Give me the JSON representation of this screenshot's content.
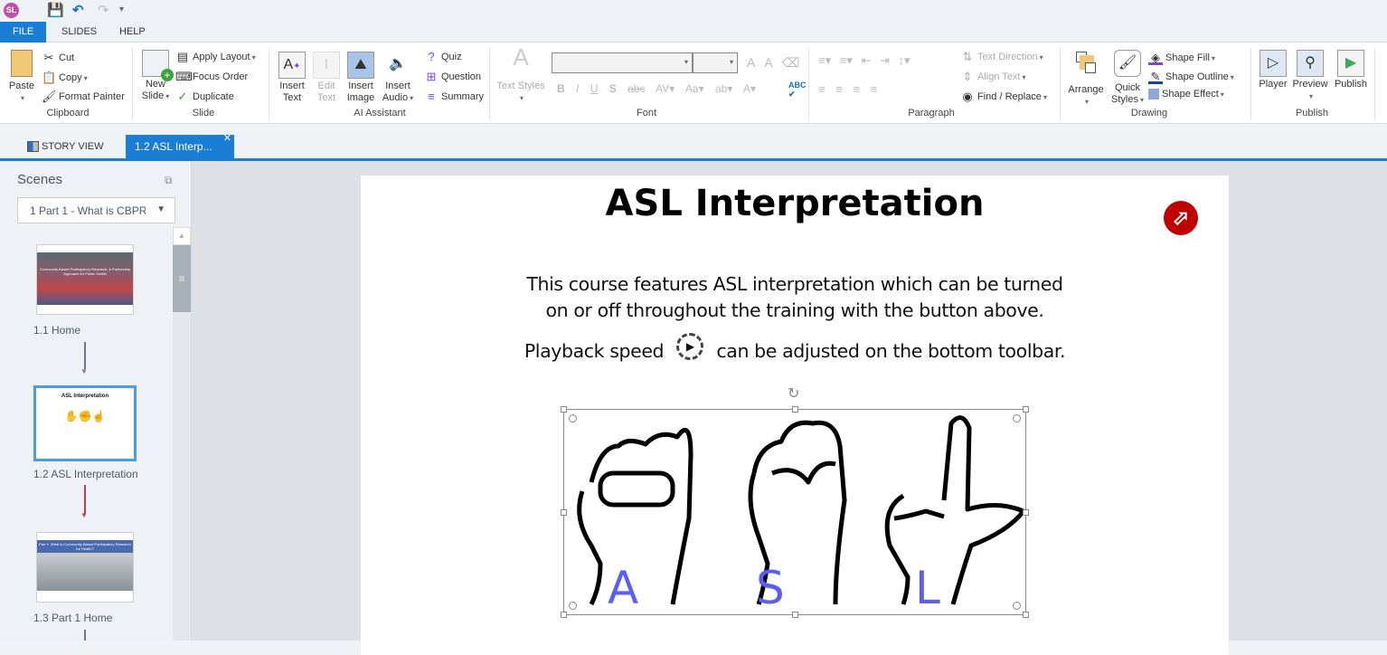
{
  "app": {
    "logo": "SL"
  },
  "menu_tabs": [
    "FILE",
    "SLIDES",
    "HELP"
  ],
  "ribbon": {
    "clipboard": {
      "label": "Clipboard",
      "paste": "Paste",
      "cut": "Cut",
      "copy": "Copy",
      "format_painter": "Format Painter"
    },
    "slide": {
      "label": "Slide",
      "new_slide_1": "New",
      "new_slide_2": "Slide",
      "apply_layout": "Apply Layout",
      "focus_order": "Focus Order",
      "duplicate": "Duplicate"
    },
    "ai": {
      "label": "AI Assistant",
      "insert_text": [
        "Insert",
        "Text"
      ],
      "edit_text": [
        "Edit",
        "Text"
      ],
      "insert_image": [
        "Insert",
        "Image"
      ],
      "insert_audio": [
        "Insert",
        "Audio"
      ],
      "quiz": "Quiz",
      "question": "Question",
      "summary": "Summary"
    },
    "font": {
      "label": "Font",
      "text_styles": "Text Styles",
      "font_name": "",
      "font_size": ""
    },
    "paragraph": {
      "label": "Paragraph",
      "text_direction": "Text Direction",
      "align_text": "Align Text",
      "find_replace": "Find / Replace"
    },
    "drawing": {
      "label": "Drawing",
      "arrange": "Arrange",
      "quick_styles": [
        "Quick",
        "Styles"
      ],
      "shape_fill": "Shape Fill",
      "shape_outline": "Shape Outline",
      "shape_effect": "Shape Effect"
    },
    "publish": {
      "label": "Publish",
      "player": "Player",
      "preview": "Preview",
      "publish": "Publish"
    }
  },
  "doc_tabs": {
    "story_view": "STORY VIEW",
    "active": "1.2 ASL Interp..."
  },
  "scenes": {
    "title": "Scenes",
    "selected_scene": "1 Part 1 - What is CBPR",
    "slides": [
      {
        "label": "1.1 Home",
        "thumb_text": "Community-Based Participatory Research: A Partnership Approach for Public Health"
      },
      {
        "label": "1.2 ASL Interpretation",
        "thumb_text": "ASL Interpretation"
      },
      {
        "label": "1.3 Part 1 Home",
        "thumb_text": "Part 1: What is Community-Based Participatory Research for Health?"
      }
    ]
  },
  "slide": {
    "title": "ASL Interpretation",
    "para1_line1": "This course features ASL interpretation which can be turned",
    "para1_line2": "on or off throughout the training with the button above.",
    "para2_before": "Playback speed",
    "para2_after": "can be adjusted on the bottom toolbar.",
    "letters": [
      "A",
      "S",
      "L"
    ]
  },
  "colors": {
    "accent": "#1a7fd4",
    "letter": "#5b5ef5",
    "button_red": "#c00000"
  }
}
